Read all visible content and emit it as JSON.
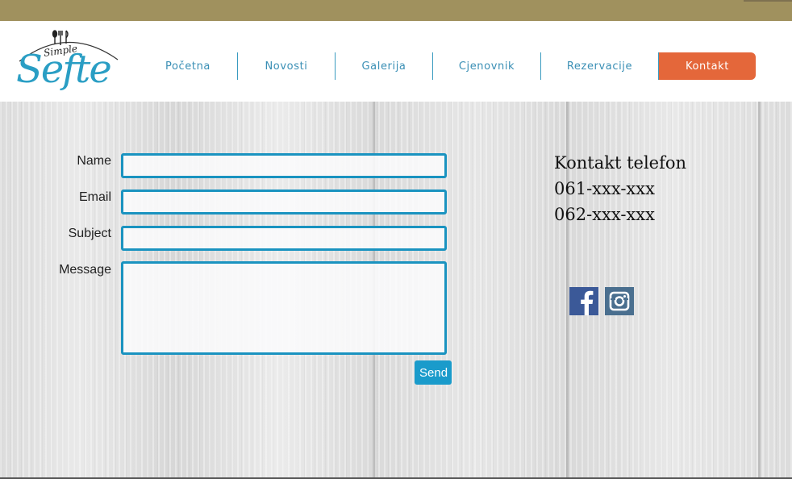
{
  "brand": {
    "small": "Simple",
    "name": "Sefte",
    "accent": "#2a9ec4"
  },
  "nav": {
    "items": [
      {
        "label": "Početna",
        "active": false
      },
      {
        "label": "Novosti",
        "active": false
      },
      {
        "label": "Galerija",
        "active": false
      },
      {
        "label": "Cjenovnik",
        "active": false
      },
      {
        "label": "Rezervacije",
        "active": false
      },
      {
        "label": "Kontakt",
        "active": true
      }
    ],
    "active_color": "#e4673a"
  },
  "form": {
    "name_label": "Name",
    "name_value": "",
    "email_label": "Email",
    "email_value": "",
    "subject_label": "Subject",
    "subject_value": "",
    "message_label": "Message",
    "message_value": "",
    "send_label": "Send",
    "border_color": "#1a93c0"
  },
  "contact": {
    "title": "Kontakt telefon",
    "phones": [
      "061-xxx-xxx",
      "062-xxx-xxx"
    ]
  },
  "social": [
    {
      "name": "facebook-icon"
    },
    {
      "name": "instagram-icon"
    }
  ]
}
